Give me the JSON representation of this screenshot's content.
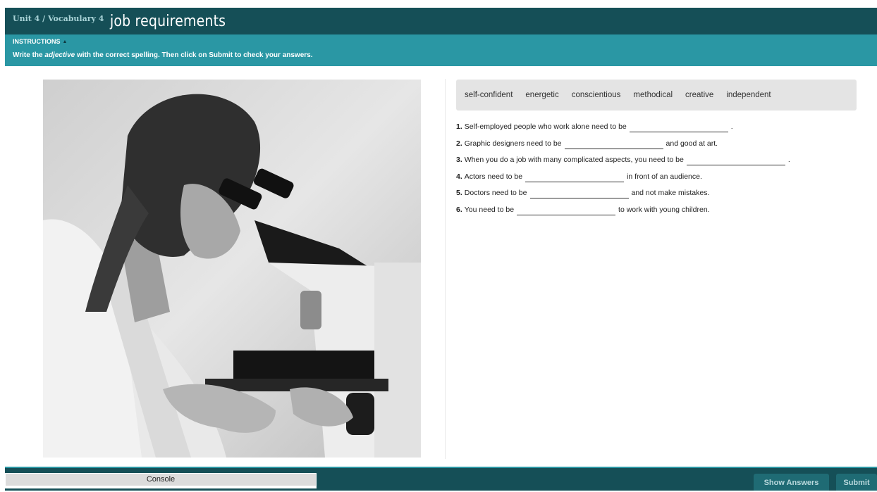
{
  "header": {
    "breadcrumb": "Unit 4 / Vocabulary 4",
    "title": "job requirements"
  },
  "instructions": {
    "label": "INSTRUCTIONS",
    "text_before": "Write the ",
    "text_em": "adjective",
    "text_after": " with the correct spelling. Then click on Submit to check your answers."
  },
  "wordbank": [
    "self-confident",
    "energetic",
    "conscientious",
    "methodical",
    "creative",
    "independent"
  ],
  "questions": [
    {
      "num": "1.",
      "before": "Self-employed people who work alone need to be",
      "after": "."
    },
    {
      "num": "2.",
      "before": "Graphic designers need to be",
      "after": "and good at art."
    },
    {
      "num": "3.",
      "before": "When you do a job with many complicated aspects, you need to be",
      "after": "."
    },
    {
      "num": "4.",
      "before": "Actors need to be",
      "after": "in front of an audience."
    },
    {
      "num": "5.",
      "before": "Doctors need to be",
      "after": "and not make mistakes."
    },
    {
      "num": "6.",
      "before": "You need to be",
      "after": "to work with young children."
    }
  ],
  "footer": {
    "console_label": "Console",
    "show_answers_label": "Show Answers",
    "submit_label": "Submit"
  },
  "colors": {
    "header_bg": "#154f57",
    "instructions_bg": "#2a97a4",
    "wordbank_bg": "#e4e4e4"
  }
}
